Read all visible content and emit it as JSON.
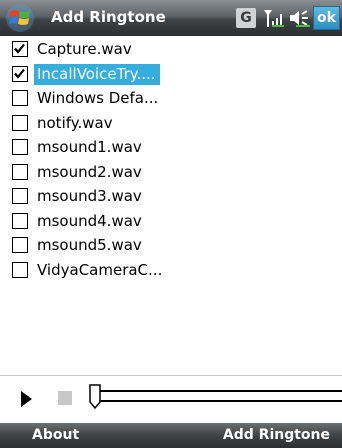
{
  "titlebar": {
    "title": "Add Ringtone",
    "ok_label": "ok",
    "g_label": "G"
  },
  "list": {
    "items": [
      {
        "label": "Capture.wav",
        "checked": true,
        "selected": false
      },
      {
        "label": "IncallVoiceTry....",
        "checked": true,
        "selected": true
      },
      {
        "label": "Windows Defa...",
        "checked": false,
        "selected": false
      },
      {
        "label": "notify.wav",
        "checked": false,
        "selected": false
      },
      {
        "label": "msound1.wav",
        "checked": false,
        "selected": false
      },
      {
        "label": "msound2.wav",
        "checked": false,
        "selected": false
      },
      {
        "label": "msound3.wav",
        "checked": false,
        "selected": false
      },
      {
        "label": "msound4.wav",
        "checked": false,
        "selected": false
      },
      {
        "label": "msound5.wav",
        "checked": false,
        "selected": false
      },
      {
        "label": "VidyaCameraC...",
        "checked": false,
        "selected": false
      }
    ]
  },
  "player": {
    "progress": 0
  },
  "menubar": {
    "left_softkey": "About",
    "right_softkey": "Add Ringtone"
  },
  "colors": {
    "selection": "#36aedd",
    "ok_button": "#2b8ec0"
  }
}
